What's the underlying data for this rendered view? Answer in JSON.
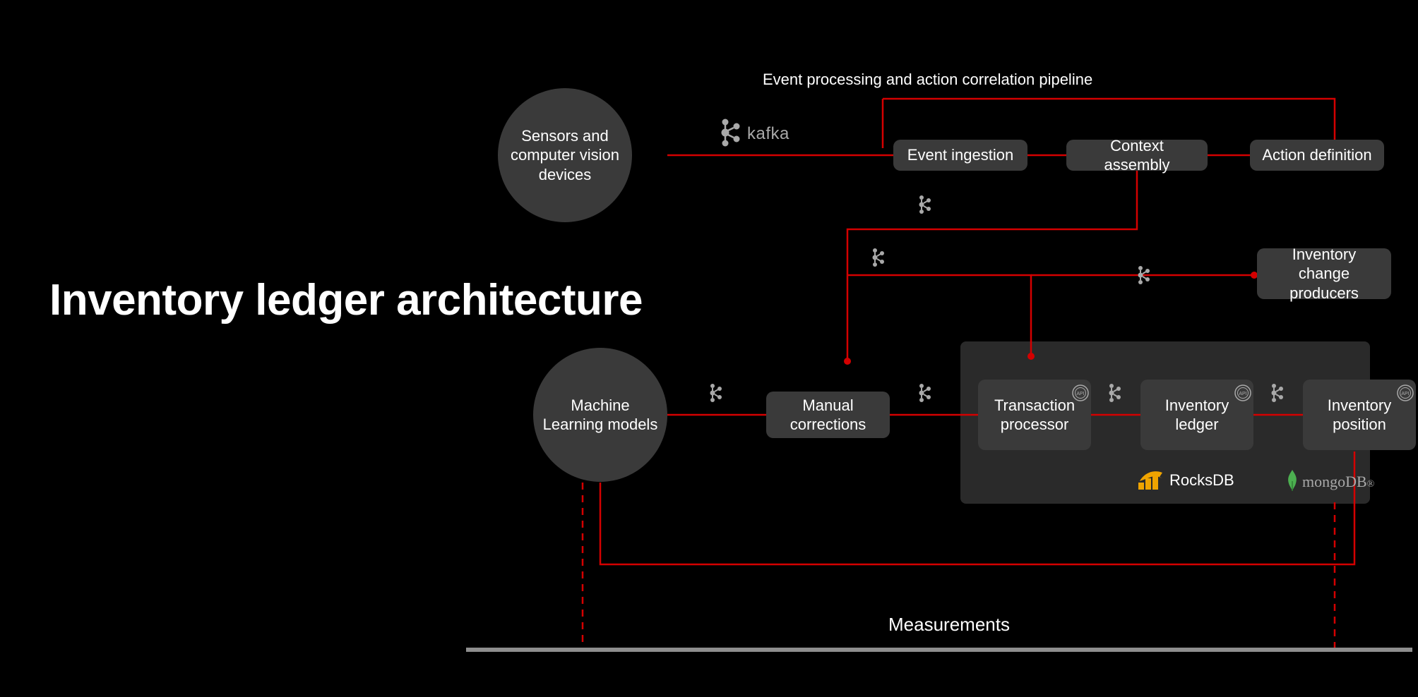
{
  "title": "Inventory ledger architecture",
  "nodes": {
    "sensors": "Sensors and computer vision devices",
    "ml_models": "Machine Learning models",
    "event_ingestion": "Event ingestion",
    "context_assembly": "Context assembly",
    "action_definition": "Action definition",
    "inventory_change_producers": "Inventory change producers",
    "manual_corrections": "Manual corrections",
    "transaction_processor": "Transaction processor",
    "inventory_ledger": "Inventory ledger",
    "inventory_position": "Inventory position"
  },
  "labels": {
    "pipeline": "Event processing and action correlation pipeline",
    "measurements": "Measurements",
    "kafka": "kafka",
    "rocksdb": "RocksDB",
    "mongodb": "mongoDB",
    "api_badge": "API"
  },
  "colors": {
    "bg": "#000000",
    "node_fill": "#3a3a3a",
    "panel_fill": "#2a2a2a",
    "flow": "#d40000",
    "baseline": "#8e8e8e",
    "icon_gray": "#a9a9a9"
  }
}
